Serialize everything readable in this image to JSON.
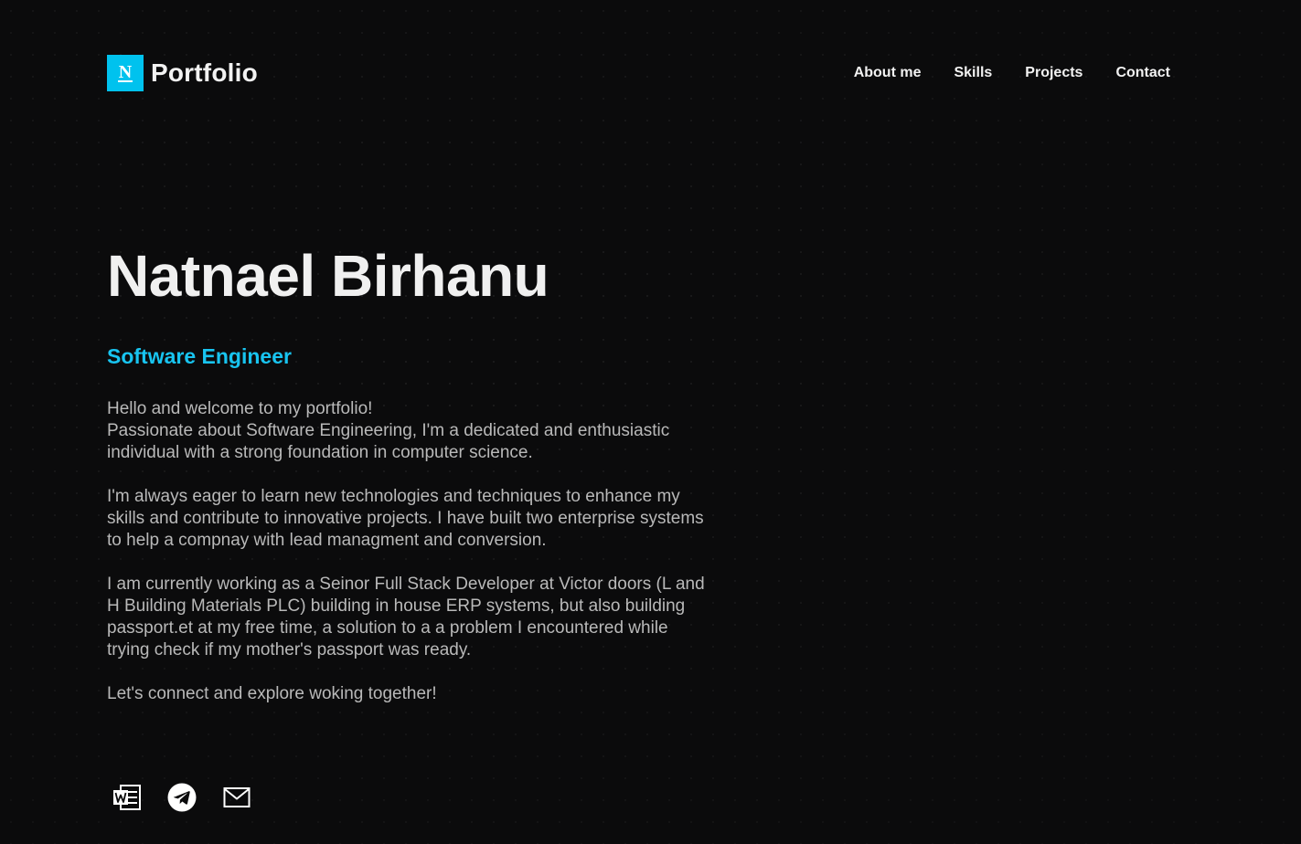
{
  "brand": {
    "logo_letter": "N",
    "name": "Portfolio"
  },
  "nav": {
    "items": [
      {
        "label": "About me"
      },
      {
        "label": "Skills"
      },
      {
        "label": "Projects"
      },
      {
        "label": "Contact"
      }
    ]
  },
  "hero": {
    "name": "Natnael Birhanu",
    "role": "Software Engineer",
    "paragraphs": [
      "Hello and welcome to my portfolio!\nPassionate about Software Engineering, I'm a dedicated and enthusiastic individual with a strong foundation in computer science.",
      "I'm always eager to learn new technologies and techniques to enhance my skills and contribute to innovative projects. I have built two enterprise systems to help a compnay with lead managment and conversion.",
      "I am currently working as a Seinor Full Stack Developer at Victor doors (L and H Building Materials PLC) building in house ERP systems, but also building passport.et at my free time, a solution to a a problem I encountered while trying check if my mother's passport was ready.",
      "Let's connect and explore woking together!"
    ]
  },
  "socials": {
    "items": [
      {
        "icon": "word-document-icon"
      },
      {
        "icon": "telegram-icon"
      },
      {
        "icon": "mail-icon"
      }
    ]
  },
  "colors": {
    "background": "#0b0b0c",
    "accent": "#00c2ee",
    "role_text": "#18c4f0",
    "body_text": "#b9b9b9",
    "heading_text": "#f0f0f0"
  }
}
